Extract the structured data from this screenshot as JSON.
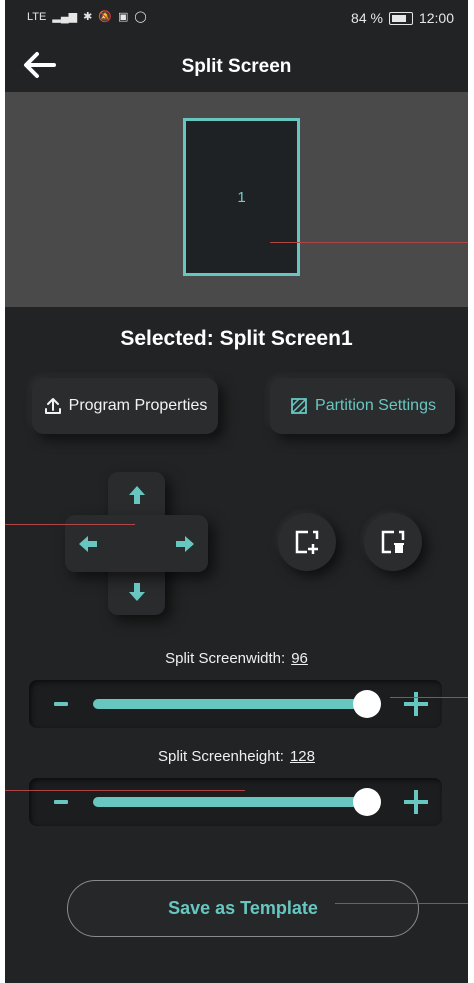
{
  "status_bar": {
    "network": "LTE",
    "battery_percent": "84 %",
    "time": "12:00"
  },
  "header": {
    "title": "Split Screen"
  },
  "preview": {
    "partition_label": "1"
  },
  "selected_label": "Selected: Split Screen1",
  "buttons": {
    "program_properties": "Program Properties",
    "partition_settings": "Partition Settings",
    "save_template": "Save as Template"
  },
  "width_slider": {
    "label": "Split Screenwidth:",
    "value": "96",
    "fraction": 0.98
  },
  "height_slider": {
    "label": "Split Screenheight:",
    "value": "128",
    "fraction": 0.98
  },
  "colors": {
    "accent": "#67c7c0",
    "background": "#222324",
    "preview_bg": "#4a4a4a"
  }
}
